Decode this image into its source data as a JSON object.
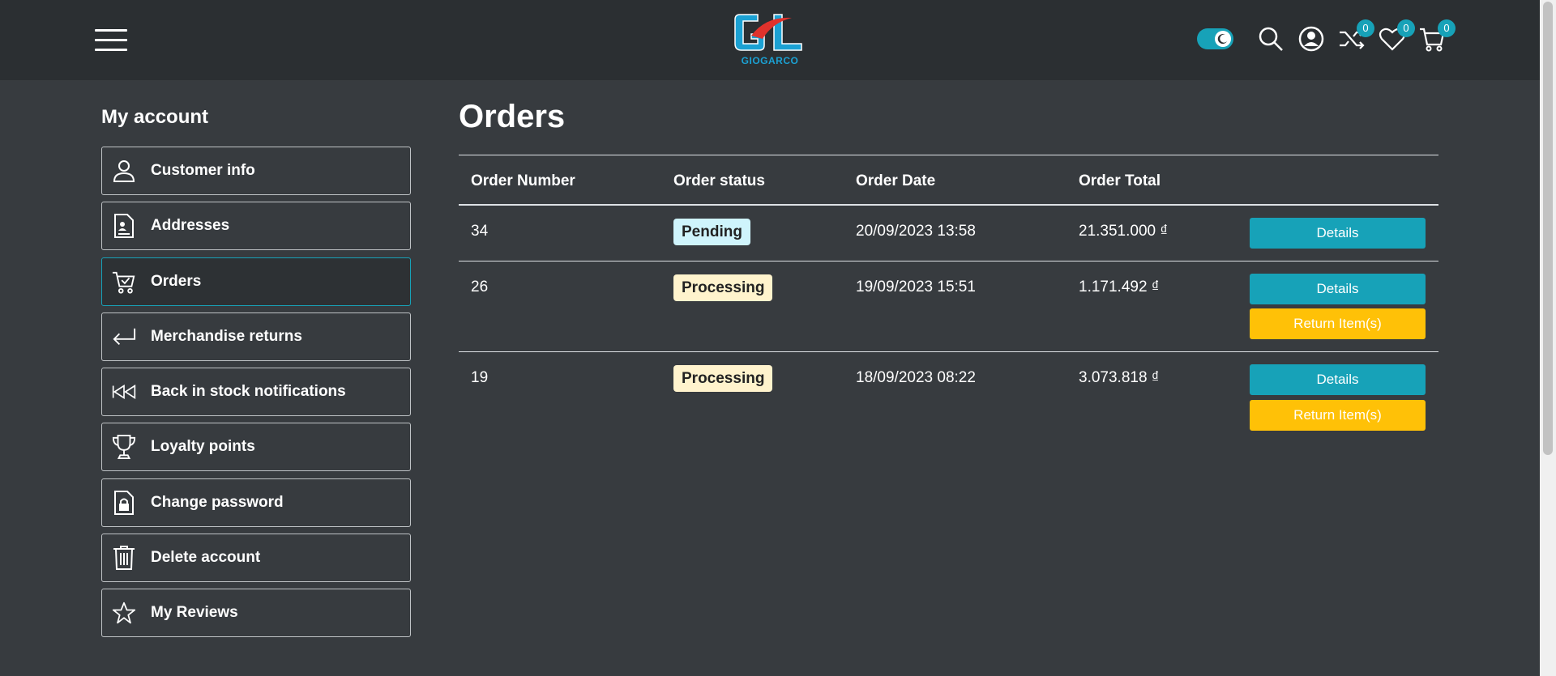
{
  "header": {
    "logo_text": "GIOGARCO",
    "compare_count": "0",
    "wishlist_count": "0",
    "cart_count": "0"
  },
  "sidebar": {
    "title": "My account",
    "items": [
      {
        "label": "Customer info",
        "icon": "user-icon"
      },
      {
        "label": "Addresses",
        "icon": "address-document-icon"
      },
      {
        "label": "Orders",
        "icon": "cart-check-icon",
        "active": true
      },
      {
        "label": "Merchandise returns",
        "icon": "return-arrow-icon"
      },
      {
        "label": "Back in stock notifications",
        "icon": "rewind-icon"
      },
      {
        "label": "Loyalty points",
        "icon": "trophy-icon"
      },
      {
        "label": "Change password",
        "icon": "lock-document-icon"
      },
      {
        "label": "Delete account",
        "icon": "trash-icon"
      },
      {
        "label": "My Reviews",
        "icon": "star-icon"
      }
    ]
  },
  "main": {
    "title": "Orders",
    "columns": [
      "Order Number",
      "Order status",
      "Order Date",
      "Order Total"
    ],
    "orders": [
      {
        "number": "34",
        "status": "Pending",
        "date": "20/09/2023 13:58",
        "total": "21.351.000 ₫",
        "details_label": "Details"
      },
      {
        "number": "26",
        "status": "Processing",
        "date": "19/09/2023 15:51",
        "total": "1.171.492 ₫",
        "details_label": "Details",
        "return_label": "Return Item(s)"
      },
      {
        "number": "19",
        "status": "Processing",
        "date": "18/09/2023 08:22",
        "total": "3.073.818 ₫",
        "details_label": "Details",
        "return_label": "Return Item(s)"
      }
    ]
  },
  "colors": {
    "background": "#373b3f",
    "header": "#2b2f32",
    "accent": "#17a2b8",
    "warning": "#ffc107",
    "pending_badge": "#cff4fc",
    "processing_badge": "#fff3cd"
  }
}
